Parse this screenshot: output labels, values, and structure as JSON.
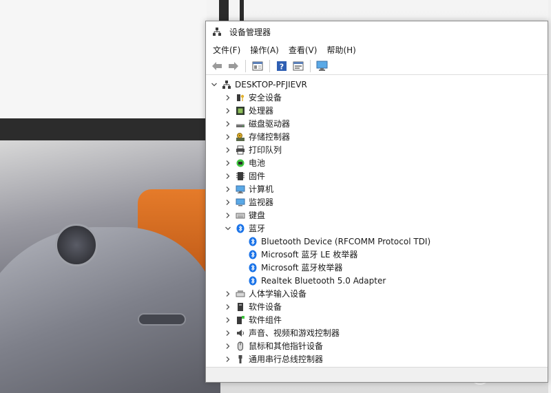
{
  "window": {
    "title": "设备管理器"
  },
  "menu": [
    {
      "id": "file",
      "label": "文件(F)"
    },
    {
      "id": "action",
      "label": "操作(A)"
    },
    {
      "id": "view",
      "label": "查看(V)"
    },
    {
      "id": "help",
      "label": "帮助(H)"
    }
  ],
  "toolbar": {
    "buttons": [
      "back-icon",
      "forward-icon",
      "properties-icon",
      "help-icon",
      "update-icon",
      "monitor-icon"
    ]
  },
  "tree": {
    "root": "DESKTOP-PFJIEVR",
    "categories": [
      {
        "label": "安全设备",
        "icon": "security-device-icon",
        "expanded": false
      },
      {
        "label": "处理器",
        "icon": "processor-icon",
        "expanded": false
      },
      {
        "label": "磁盘驱动器",
        "icon": "disk-drive-icon",
        "expanded": false
      },
      {
        "label": "存储控制器",
        "icon": "storage-controller-icon",
        "expanded": false
      },
      {
        "label": "打印队列",
        "icon": "printer-icon",
        "expanded": false
      },
      {
        "label": "电池",
        "icon": "battery-icon",
        "expanded": false
      },
      {
        "label": "固件",
        "icon": "firmware-icon",
        "expanded": false
      },
      {
        "label": "计算机",
        "icon": "computer-icon",
        "expanded": false
      },
      {
        "label": "监视器",
        "icon": "monitor-icon",
        "expanded": false
      },
      {
        "label": "键盘",
        "icon": "keyboard-icon",
        "expanded": false
      },
      {
        "label": "蓝牙",
        "icon": "bluetooth-icon",
        "expanded": true,
        "children": [
          "Bluetooth Device (RFCOMM Protocol TDI)",
          "Microsoft 蓝牙 LE 枚举器",
          "Microsoft 蓝牙枚举器",
          "Realtek Bluetooth 5.0 Adapter"
        ]
      },
      {
        "label": "人体学输入设备",
        "icon": "hid-icon",
        "expanded": false
      },
      {
        "label": "软件设备",
        "icon": "software-device-icon",
        "expanded": false
      },
      {
        "label": "软件组件",
        "icon": "software-component-icon",
        "expanded": false
      },
      {
        "label": "声音、视频和游戏控制器",
        "icon": "sound-icon",
        "expanded": false
      },
      {
        "label": "鼠标和其他指针设备",
        "icon": "mouse-icon",
        "expanded": false
      },
      {
        "label": "通用串行总线控制器",
        "icon": "usb-icon",
        "expanded": false
      }
    ]
  },
  "colors": {
    "bluetooth": "#1a73e8",
    "window_bg": "#ffffff",
    "status_bg": "#f0f0f0"
  }
}
